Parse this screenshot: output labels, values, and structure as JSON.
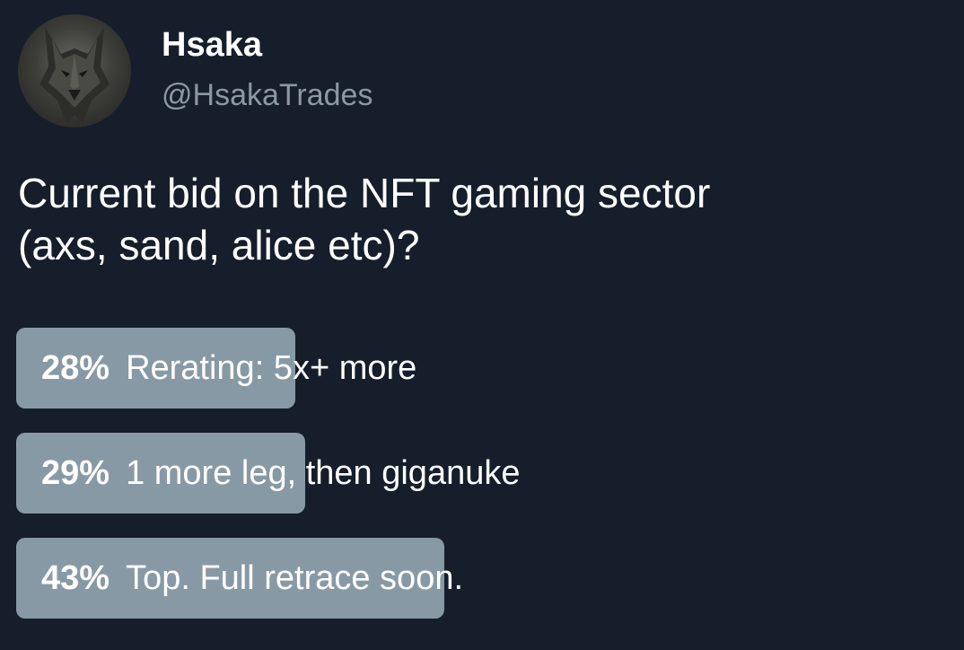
{
  "tweet": {
    "display_name": "Hsaka",
    "handle": "@HsakaTrades",
    "text_line1": "Current bid on the NFT gaming sector",
    "text_line2": "(axs, sand, alice etc)?"
  },
  "poll": {
    "options": [
      {
        "percent_label": "28%",
        "label": "Rerating: 5x+ more",
        "percent": 28
      },
      {
        "percent_label": "29%",
        "label": "1 more leg, then giganuke",
        "percent": 29
      },
      {
        "percent_label": "43%",
        "label": "Top. Full retrace soon.",
        "percent": 43
      }
    ]
  },
  "colors": {
    "background": "#161e2b",
    "poll_bar": "#8899a6",
    "handle_text": "#8b98a5",
    "text": "#ffffff"
  },
  "icons": {
    "avatar": "wolf-avatar"
  }
}
